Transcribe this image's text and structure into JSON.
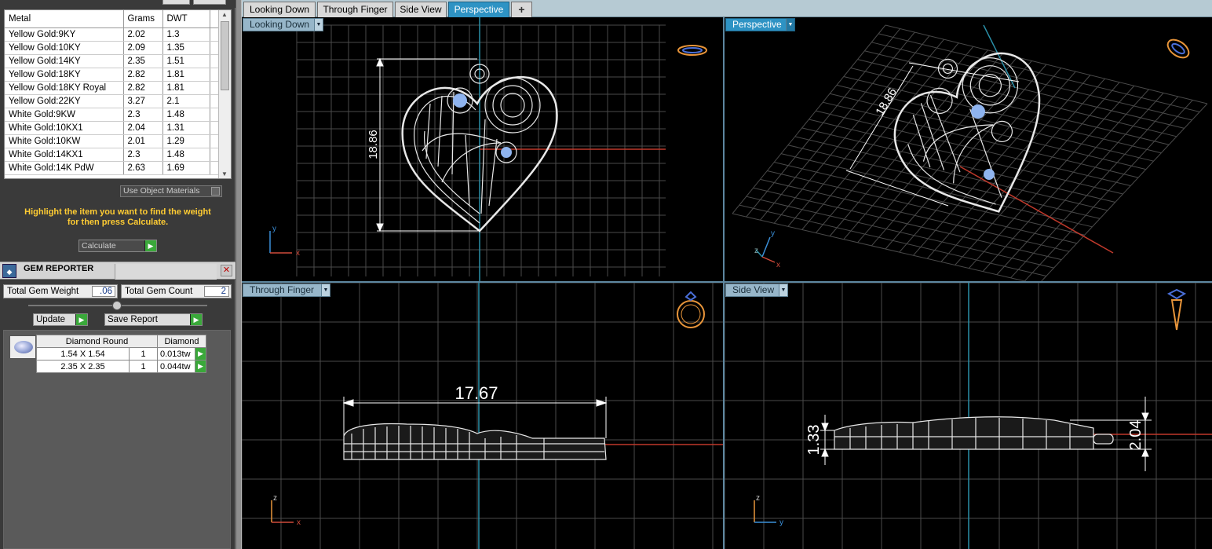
{
  "metal_table": {
    "headers": [
      "Metal",
      "Grams",
      "DWT"
    ],
    "rows": [
      [
        "Yellow Gold:9KY",
        "2.02",
        "1.3"
      ],
      [
        "Yellow Gold:10KY",
        "2.09",
        "1.35"
      ],
      [
        "Yellow Gold:14KY",
        "2.35",
        "1.51"
      ],
      [
        "Yellow Gold:18KY",
        "2.82",
        "1.81"
      ],
      [
        "Yellow Gold:18KY Royal",
        "2.82",
        "1.81"
      ],
      [
        "Yellow Gold:22KY",
        "3.27",
        "2.1"
      ],
      [
        "White Gold:9KW",
        "2.3",
        "1.48"
      ],
      [
        "White Gold:10KX1",
        "2.04",
        "1.31"
      ],
      [
        "White Gold:10KW",
        "2.01",
        "1.29"
      ],
      [
        "White Gold:14KX1",
        "2.3",
        "1.48"
      ],
      [
        "White Gold:14K PdW",
        "2.63",
        "1.69"
      ]
    ]
  },
  "use_object_materials_label": "Use Object Materials",
  "hint_line1": "Highlight the item you want to find the weight",
  "hint_line2": "for then press Calculate.",
  "calculate_label": "Calculate",
  "gem_reporter": {
    "title": "GEM REPORTER",
    "total_weight_label": "Total Gem Weight",
    "total_weight_value": ".06",
    "total_count_label": "Total Gem Count",
    "total_count_value": "2",
    "update_label": "Update",
    "save_report_label": "Save Report",
    "table_headers": [
      "Diamond Round",
      "Diamond"
    ],
    "rows": [
      {
        "size": "1.54 X 1.54",
        "qty": "1",
        "weight": "0.013tw"
      },
      {
        "size": "2.35 X 2.35",
        "qty": "1",
        "weight": "0.044tw"
      }
    ]
  },
  "tabs": [
    {
      "label": "Looking Down"
    },
    {
      "label": "Through Finger"
    },
    {
      "label": "Side View"
    },
    {
      "label": "Perspective",
      "active": true
    },
    {
      "label": "+"
    }
  ],
  "viewports": {
    "looking_down": {
      "label": "Looking Down",
      "dimension": "18.86"
    },
    "perspective": {
      "label": "Perspective",
      "dimension": "18.86"
    },
    "through_finger": {
      "label": "Through Finger",
      "dimension": "17.67"
    },
    "side_view": {
      "label": "Side View",
      "dimension_left": "1.33",
      "dimension_right": "2.04"
    }
  },
  "axis_labels": {
    "x": "x",
    "y": "y",
    "z": "z"
  },
  "colors": {
    "accent": "#2e93c4",
    "grid": "#4a4a4a",
    "axis_red": "#c0392b",
    "axis_teal": "#2a8fa8",
    "hint": "#ffcc33",
    "go_green": "#3aa83a",
    "model": "#e8e8e8"
  }
}
